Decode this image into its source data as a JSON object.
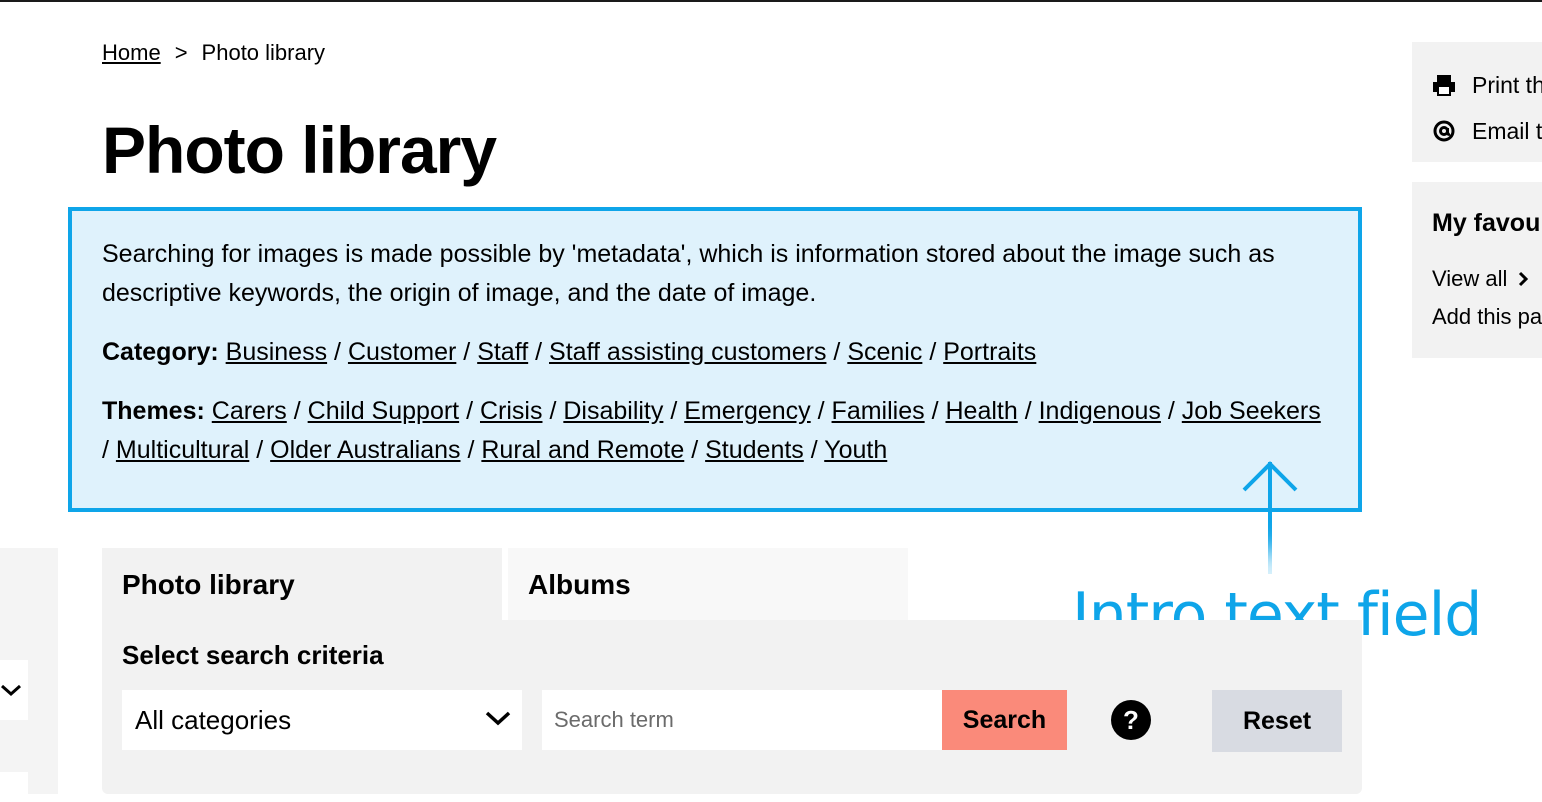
{
  "breadcrumb": {
    "home": "Home",
    "separator": ">",
    "current": "Photo library"
  },
  "page": {
    "title": "Photo library"
  },
  "intro": {
    "description": "Searching for images is made possible by 'metadata', which is information stored about the image such as descriptive keywords, the origin of image, and the date of image.",
    "category_label": "Category:",
    "categories": [
      "Business",
      "Customer",
      "Staff",
      "Staff assisting customers",
      "Scenic",
      "Portraits"
    ],
    "themes_label": "Themes:",
    "themes": [
      "Carers",
      "Child Support",
      "Crisis",
      "Disability",
      "Emergency",
      "Families",
      "Health",
      "Indigenous",
      "Job Seekers",
      "Multicultural",
      "Older Australians",
      "Rural and Remote",
      "Students",
      "Youth"
    ],
    "divider": "/"
  },
  "annotation": {
    "label": "Intro text field",
    "color": "#0ea5e9"
  },
  "tabs": [
    {
      "label": "Photo library",
      "active": true
    },
    {
      "label": "Albums",
      "active": false
    }
  ],
  "search": {
    "criteria_label": "Select search criteria",
    "category_select": "All categories",
    "placeholder": "Search term",
    "search_label": "Search",
    "help_label": "?",
    "reset_label": "Reset",
    "search_color": "#fa8a7a",
    "reset_color": "#d8dbe2"
  },
  "sidebar": {
    "print": "Print th",
    "email": "Email t",
    "favourites_title": "My favou",
    "view_all": "View all",
    "add_page": "Add this pa"
  },
  "icons": {
    "print": "printer-icon",
    "email": "at-sign-icon",
    "chevron": "chevron-down-icon",
    "arrow": "arrow-up-icon"
  }
}
